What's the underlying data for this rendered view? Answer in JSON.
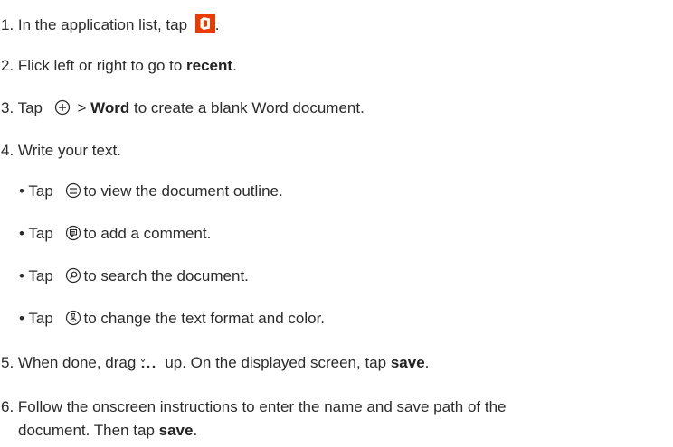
{
  "steps": {
    "s1": {
      "prefix": "1. In the application list, tap",
      "suffix": "."
    },
    "s2": {
      "prefix": "2. Flick left or right to go to ",
      "bold": "recent",
      "suffix": "."
    },
    "s3": {
      "prefix": "3. Tap",
      "mid": " > ",
      "bold": "Word",
      "suffix": " to create a blank Word document."
    },
    "s4": {
      "text": "4. Write your text."
    },
    "b1": {
      "prefix": "• Tap",
      "suffix": "to view the document outline."
    },
    "b2": {
      "prefix": "• Tap",
      "suffix": "to add a comment."
    },
    "b3": {
      "prefix": "• Tap",
      "suffix": "to search the document."
    },
    "b4": {
      "prefix": "• Tap",
      "suffix": "to change the text format and color."
    },
    "s5": {
      "prefix": "5. When done, drag",
      "mid": "up. On the displayed screen, tap ",
      "bold": "save",
      "suffix": "."
    },
    "s6": {
      "line1": "6. Follow the onscreen instructions to enter the name and save path of the",
      "line2_prefix": "document. Then tap ",
      "bold": "save",
      "suffix": "."
    }
  },
  "icons": {
    "office": "office-app-icon",
    "new": "plus-circle-icon",
    "outline": "outline-icon",
    "comment": "comment-icon",
    "search": "search-icon",
    "format": "text-format-icon",
    "drag": "more-dots-icon"
  },
  "colors": {
    "office_icon": "#eb3c00",
    "text": "#2b2b2b"
  }
}
